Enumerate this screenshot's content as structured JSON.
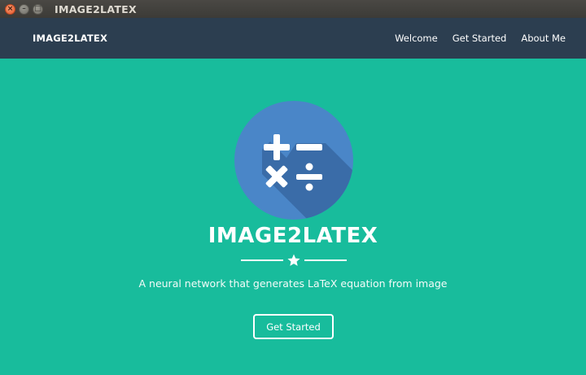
{
  "window": {
    "title": "IMAGE2LATEX",
    "close_glyph": "×",
    "minimize_glyph": "–",
    "maximize_glyph": "□"
  },
  "navbar": {
    "brand": "IMAGE2LATEX",
    "links": [
      {
        "label": "Welcome"
      },
      {
        "label": "Get Started"
      },
      {
        "label": "About Me"
      }
    ]
  },
  "hero": {
    "logo_icon": "math-operators-icon",
    "title": "IMAGE2LATEX",
    "divider_icon": "star-icon",
    "subtitle": "A neural network that generates LaTeX equation from image",
    "button_label": "Get Started"
  },
  "colors": {
    "background": "#18bc9c",
    "navbar": "#2c3e50",
    "logo_circle": "#4a86c8",
    "logo_shadow": "#3a6ca8",
    "text": "#ffffff"
  }
}
